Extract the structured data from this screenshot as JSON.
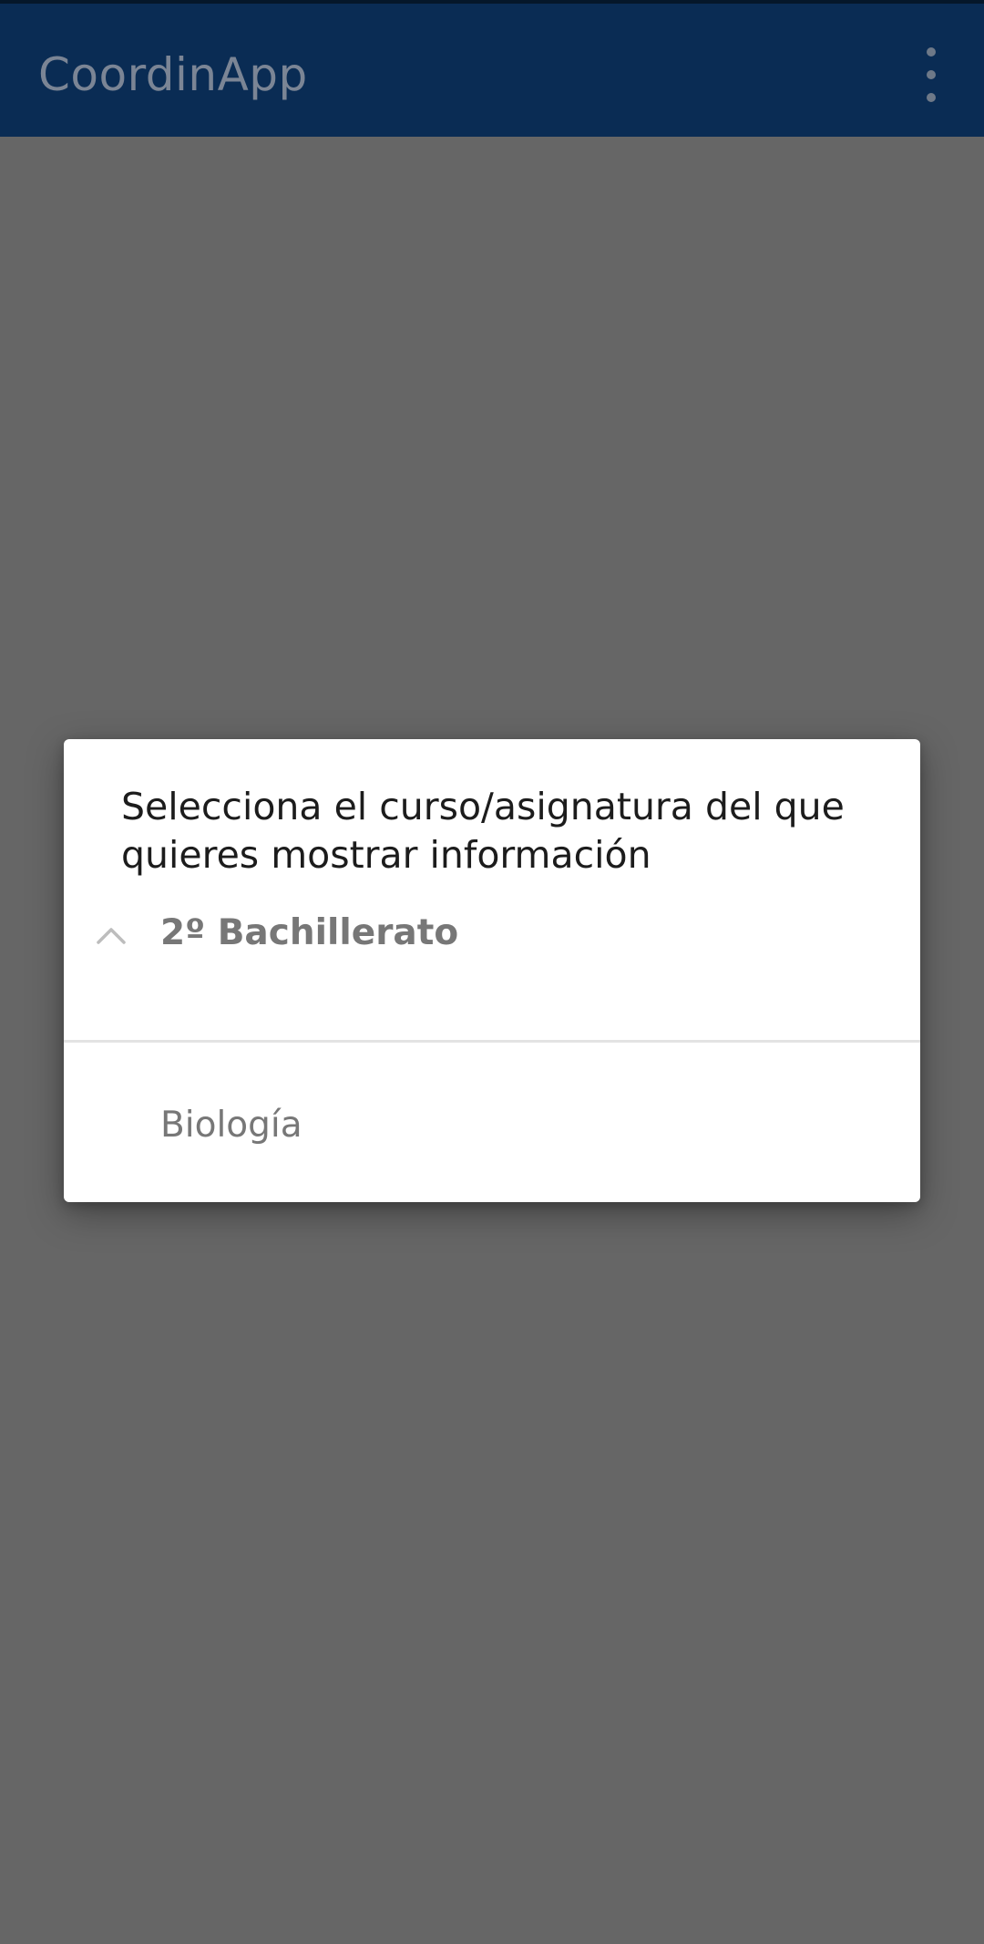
{
  "app_bar": {
    "title": "CoordinApp",
    "overflow_icon": "more-vert-icon",
    "background": "#0a2c54"
  },
  "dialog": {
    "title": "Selecciona el curso/asignatura del que quieres mostrar información",
    "groups": [
      {
        "label": "2º Bachillerato",
        "expanded": true,
        "icon": "chevron-up-icon",
        "items": [
          {
            "label": "Biología"
          }
        ]
      }
    ]
  },
  "colors": {
    "scrim": "#666666",
    "dialog_background": "#ffffff",
    "title_text": "#1c1c1c",
    "secondary_text": "#777777"
  }
}
